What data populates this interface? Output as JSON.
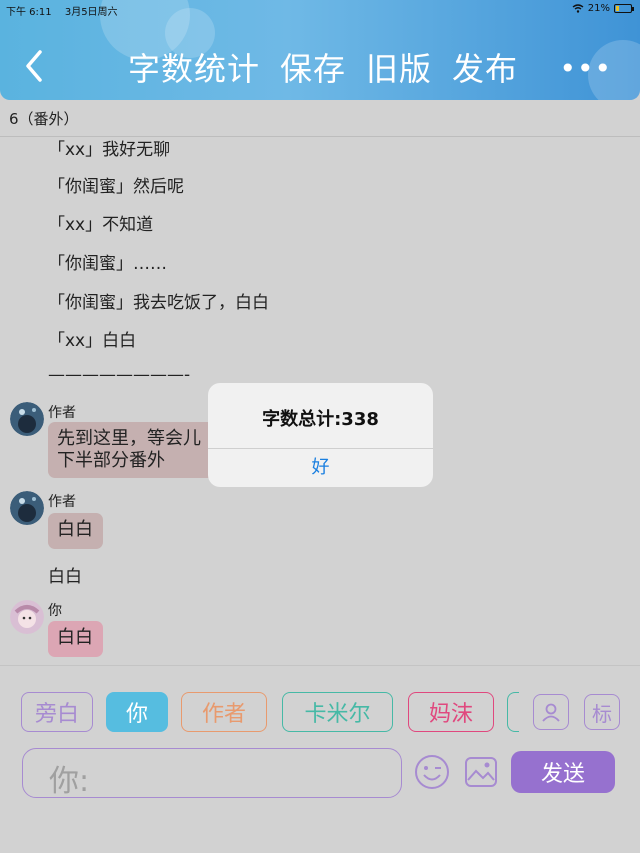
{
  "status_bar": {
    "time": "下午 6:11",
    "date": "3月5日周六",
    "battery": "21%",
    "battery_level": 0.21
  },
  "nav": {
    "actions": [
      "字数统计",
      "保存",
      "旧版",
      "发布"
    ],
    "more": "•••"
  },
  "subtitle": "6（番外）",
  "lines": [
    "「xx」我好无聊",
    "「你闺蜜」然后呢",
    "「xx」不知道",
    "「你闺蜜」……",
    "「你闺蜜」我去吃饭了，白白",
    "「xx」白白",
    "————————-"
  ],
  "messages": [
    {
      "name": "作者",
      "text": "先到这里，等会儿"
    },
    {
      "name": "",
      "text": "下半部分番外"
    },
    {
      "name": "作者",
      "text": "白白"
    },
    {
      "name": "",
      "text": "白白"
    },
    {
      "name": "你",
      "text": "白白"
    }
  ],
  "roles": [
    "旁白",
    "你",
    "作者",
    "卡米尔",
    "妈沫"
  ],
  "toolbar": {
    "tag_label": "标",
    "input_placeholder": "你:",
    "send_label": "发送"
  },
  "dialog": {
    "title": "字数总计:338",
    "ok_label": "好"
  },
  "colors": {
    "header": "#5ab3df",
    "accent": "#9671cf",
    "selected_role": "#56bde0",
    "link_blue": "#1a7fe0"
  }
}
